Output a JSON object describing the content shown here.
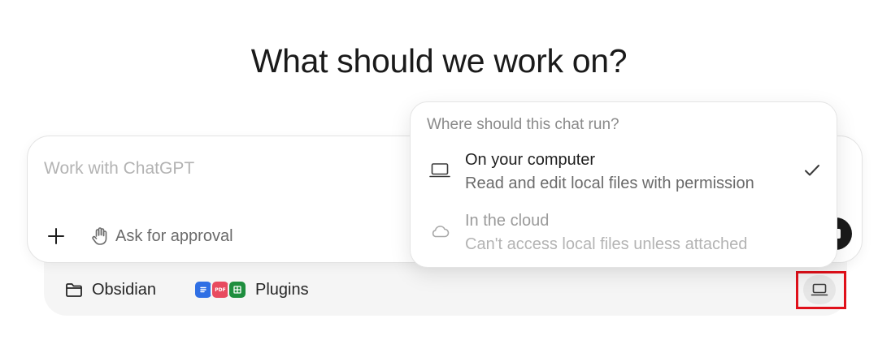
{
  "heading": "What should we work on?",
  "composer": {
    "input_value": "",
    "placeholder": "Work with ChatGPT",
    "add_icon": "plus-icon",
    "approval": {
      "label": "Ask for approval",
      "icon": "hand-icon"
    },
    "send_icon": "send-icon"
  },
  "context_bar": {
    "folder": {
      "label": "Obsidian",
      "icon": "folder-icon"
    },
    "plugins": {
      "label": "Plugins",
      "icons": [
        "docs-icon",
        "pdf-icon",
        "sheets-icon"
      ],
      "pdf_text": "PDF"
    },
    "run_location_icon": "laptop-icon"
  },
  "run_location_menu": {
    "title": "Where should this chat run?",
    "options": [
      {
        "title": "On your computer",
        "description": "Read and edit local files with permission",
        "icon": "laptop-icon",
        "selected": true
      },
      {
        "title": "In the cloud",
        "description": "Can't access local files unless attached",
        "icon": "cloud-icon",
        "selected": false
      }
    ]
  },
  "colors": {
    "highlight": "#e0101a",
    "docs": "#2f6fe4",
    "pdf": "#e84a5f",
    "sheets": "#1e8e3e"
  }
}
